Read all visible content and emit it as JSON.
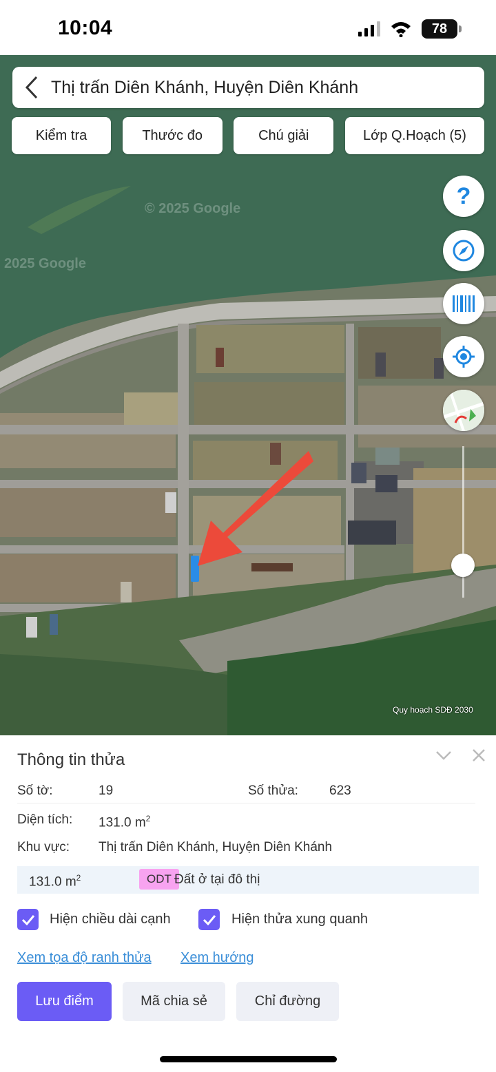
{
  "status": {
    "time": "10:04",
    "battery": "78"
  },
  "search": {
    "title": "Thị trấn Diên Khánh, Huyện Diên Khánh"
  },
  "toolbar": [
    "Kiểm tra",
    "Thước đo",
    "Chú giải",
    "Lớp Q.Hoạch (5)"
  ],
  "map": {
    "watermark_1": "© 2025 Google",
    "watermark_2": "2025 Google",
    "attribution": "Quy hoạch SDĐ 2030",
    "help_glyph": "?"
  },
  "panel": {
    "title": "Thông tin thửa",
    "so_to_label": "Số tờ:",
    "so_to_value": "19",
    "so_thua_label": "Số thửa:",
    "so_thua_value": "623",
    "dien_tich_label": "Diện tích:",
    "dien_tich_value": "131.0 m",
    "unit_sup": "2",
    "khu_vuc_label": "Khu vực:",
    "khu_vuc_value": "Thị trấn Diên Khánh, Huyện Diên Khánh",
    "land_area": "131.0 m",
    "land_code": "ODT",
    "land_desc": "Đất ở tại đô thị",
    "check_1": "Hiện chiều dài cạnh",
    "check_2": "Hiện thửa xung quanh",
    "link_1": "Xem tọa độ ranh thửa",
    "link_2": "Xem hướng",
    "btn_save": "Lưu điểm",
    "btn_share": "Mã chia sẻ",
    "btn_route": "Chỉ đường"
  },
  "colors": {
    "accent": "#6b5cf5",
    "link": "#3a8ed8",
    "badge": "#f8a3f0",
    "arrow": "#ec4a3a"
  }
}
